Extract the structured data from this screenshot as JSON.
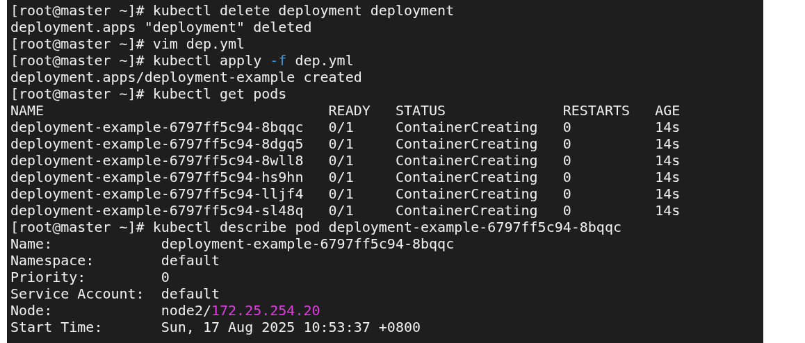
{
  "terminal": {
    "lines": [
      {
        "segments": [
          {
            "text": "[root@master ~]# kubectl delete deployment deployment"
          }
        ]
      },
      {
        "segments": [
          {
            "text": "deployment.apps \"deployment\" deleted"
          }
        ]
      },
      {
        "segments": [
          {
            "text": "[root@master ~]# vim dep.yml"
          }
        ]
      },
      {
        "segments": [
          {
            "text": "[root@master ~]# kubectl apply "
          },
          {
            "text": "-f",
            "color": "#3b9ae1"
          },
          {
            "text": " dep.yml"
          }
        ]
      },
      {
        "segments": [
          {
            "text": "deployment.apps/deployment-example created"
          }
        ]
      },
      {
        "segments": [
          {
            "text": "[root@master ~]# kubectl get pods"
          }
        ]
      },
      {
        "segments": [
          {
            "text": "NAME                                  READY   STATUS              RESTARTS   AGE"
          }
        ]
      },
      {
        "segments": [
          {
            "text": "deployment-example-6797ff5c94-8bqqc   0/1     ContainerCreating   0          14s"
          }
        ]
      },
      {
        "segments": [
          {
            "text": "deployment-example-6797ff5c94-8dgq5   0/1     ContainerCreating   0          14s"
          }
        ]
      },
      {
        "segments": [
          {
            "text": "deployment-example-6797ff5c94-8wll8   0/1     ContainerCreating   0          14s"
          }
        ]
      },
      {
        "segments": [
          {
            "text": "deployment-example-6797ff5c94-hs9hn   0/1     ContainerCreating   0          14s"
          }
        ]
      },
      {
        "segments": [
          {
            "text": "deployment-example-6797ff5c94-lljf4   0/1     ContainerCreating   0          14s"
          }
        ]
      },
      {
        "segments": [
          {
            "text": "deployment-example-6797ff5c94-sl48q   0/1     ContainerCreating   0          14s"
          }
        ]
      },
      {
        "segments": [
          {
            "text": "[root@master ~]# kubectl describe pod deployment-example-6797ff5c94-8bqqc"
          }
        ]
      },
      {
        "segments": [
          {
            "text": "Name:             deployment-example-6797ff5c94-8bqqc"
          }
        ]
      },
      {
        "segments": [
          {
            "text": "Namespace:        default"
          }
        ]
      },
      {
        "segments": [
          {
            "text": "Priority:         0"
          }
        ]
      },
      {
        "segments": [
          {
            "text": "Service Account:  default"
          }
        ]
      },
      {
        "segments": [
          {
            "text": "Node:             node2/"
          },
          {
            "text": "172.25.254.20",
            "color": "#e53be5"
          }
        ]
      },
      {
        "segments": [
          {
            "text": "Start Time:       Sun, 17 Aug 2025 10:53:37 +0800"
          }
        ]
      }
    ]
  }
}
